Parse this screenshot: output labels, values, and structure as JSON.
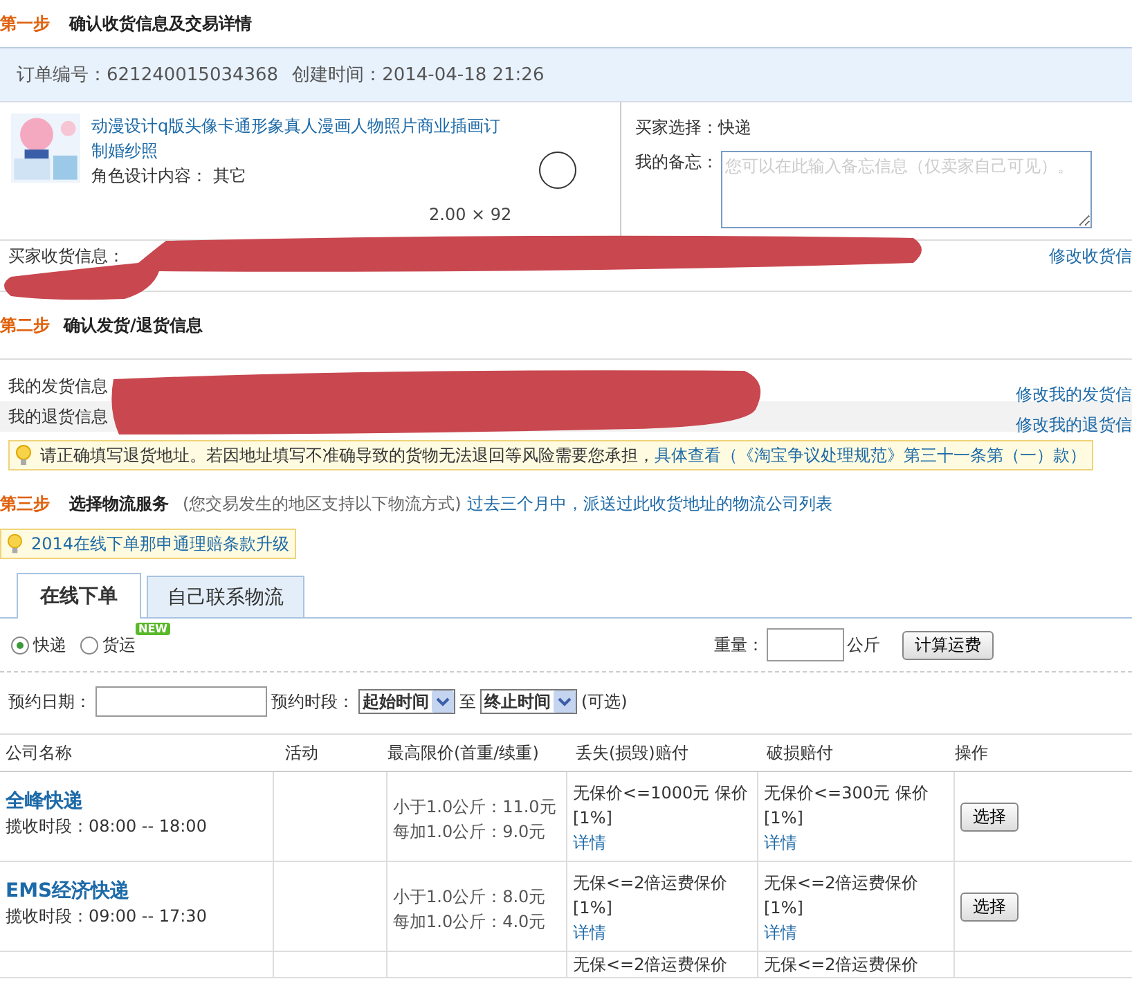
{
  "step1": {
    "step": "第一步",
    "title": "确认收货信息及交易详情"
  },
  "order": {
    "number": "订单编号：621240015034368",
    "created": "创建时间：2014-04-18 21:26"
  },
  "product": {
    "title": "动漫设计q版头像卡通形象真人漫画人物照片商业插画订制婚纱照",
    "option": "角色设计内容： 其它",
    "price_qty": "2.00 × 92"
  },
  "buyer_choice": "买家选择：快递",
  "memo": {
    "label": "我的备忘：",
    "placeholder": "您可以在此输入备忘信息（仅卖家自己可见）。"
  },
  "address": {
    "label": "买家收货信息：",
    "link": "修改收货信"
  },
  "step2": {
    "step": "第二步",
    "title": "确认发货/退货信息"
  },
  "seller_rows": [
    {
      "label": "我的发货信息",
      "link": "修改我的发货信"
    },
    {
      "label": "我的退货信息",
      "link": "修改我的退货信"
    }
  ],
  "notice1": {
    "text": "请正确填写退货地址。若因地址填写不准确导致的货物无法退回等风险需要您承担，",
    "link": "具体查看（《淘宝争议处理规范》第三十一条第（一）款）"
  },
  "step3": {
    "step": "第三步",
    "title": "选择物流服务",
    "note": "(您交易发生的地区支持以下物流方式)",
    "link": "过去三个月中，派送过此收货地址的物流公司列表"
  },
  "notice2": {
    "link": "2014在线下单那申通理赔条款升级"
  },
  "tabs": [
    {
      "label": "在线下单",
      "selected": true
    },
    {
      "label": "自己联系物流",
      "selected": false
    }
  ],
  "radios": [
    {
      "label": "快递",
      "selected": true
    },
    {
      "label": "货运",
      "selected": false,
      "badge": "NEW"
    }
  ],
  "weight": {
    "label": "重量：",
    "unit": "公斤",
    "button": "计算运费"
  },
  "booking": {
    "date_label": "预约日期：",
    "period_label": "预约时段：",
    "start": "起始时间",
    "to": "至",
    "end": "终止时间",
    "optional": "(可选)"
  },
  "columns": [
    "公司名称",
    "活动",
    "最高限价(首重/续重)",
    "丢失(损毁)赔付",
    "破损赔付",
    "操作"
  ],
  "rows": [
    {
      "name": "全峰快递",
      "hours": "揽收时段：08:00 -- 18:00",
      "price": [
        "小于1.0公斤：11.0元",
        "每加1.0公斤：9.0元"
      ],
      "loss": "无保价<=1000元 保价[1%]",
      "loss_link": "详情",
      "damage": "无保价<=300元 保价[1%]",
      "damage_link": "详情",
      "button": "选择"
    },
    {
      "name": "EMS经济快递",
      "hours": "揽收时段：09:00 -- 17:30",
      "price": [
        "小于1.0公斤：8.0元",
        "每加1.0公斤：4.0元"
      ],
      "loss": "无保<=2倍运费保价[1%]",
      "loss_link": "详情",
      "damage": "无保<=2倍运费保价[1%]",
      "damage_link": "详情",
      "button": "选择"
    }
  ],
  "partial_row": {
    "loss": "无保<=2倍运费保价",
    "damage": "无保<=2倍运费保价"
  }
}
